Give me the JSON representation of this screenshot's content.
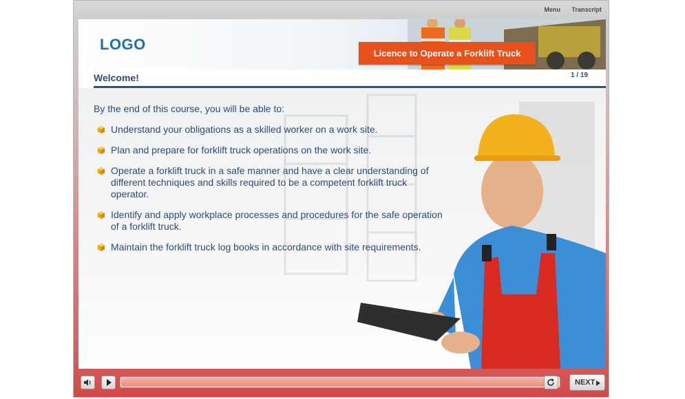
{
  "topnav": {
    "menu": "Menu",
    "transcript": "Transcript"
  },
  "banner": {
    "logo": "LOGO",
    "course_title": "Licence to Operate a Forklift Truck",
    "accent_color": "#e8501c"
  },
  "header": {
    "page_title": "Welcome!",
    "page_counter": "1 / 19"
  },
  "content": {
    "intro": "By the end of this course, you will be able to:",
    "bullets": [
      "Understand your obligations as a skilled worker on a work site.",
      "Plan and prepare for forklift truck operations on the work site.",
      "Operate a forklift truck in a safe manner and have a clear understanding of different techniques and skills required to be a competent forklift truck operator.",
      "Identify and apply workplace processes and procedures for the safe operation of a forklift truck.",
      "Maintain the forklift truck log books in accordance with site requirements."
    ],
    "bullet_icon": "orange-cube-icon",
    "text_color": "#2e4a7a"
  },
  "controls": {
    "mute_icon": "speaker-icon",
    "play_icon": "play-icon",
    "replay_icon": "replay-icon",
    "next_label": "NEXT",
    "progress": 1.0
  }
}
